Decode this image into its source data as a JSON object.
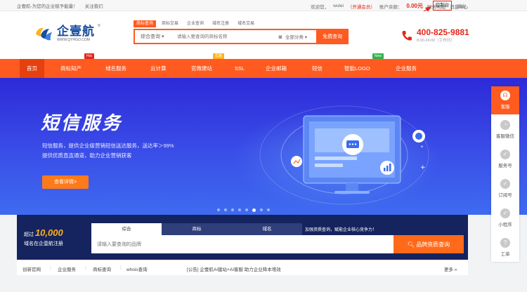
{
  "topbar": {
    "site_slogan": "企壹航-为您的企业赋予能量！",
    "follow": "关注我们",
    "welcome": "欢迎您，",
    "user": "wulei",
    "vip_open": "（开通会员）",
    "balance_label": "账户余额：",
    "balance_value": "0.00元",
    "finance": "财务明细",
    "message_center": "消息中心",
    "console": "控制台",
    "logout": "退出"
  },
  "logo": {
    "cn": "企壹航",
    "en": "WWW.QYHGO.COM",
    "reg": "®"
  },
  "search": {
    "tabs": [
      "商标查询",
      "商标交易",
      "企业查询",
      "域名注册",
      "域名交易"
    ],
    "category": "综合查询 ▾",
    "placeholder": "请输入要查询的商标名称",
    "scope": "全部分类 ▾",
    "button": "免费查询"
  },
  "hotline": {
    "number": "400-825-9881",
    "hours": "8:00-24:00（工作日）"
  },
  "nav": {
    "items": [
      "首页",
      "商标知产",
      "域名服务",
      "云计算",
      "官微建站",
      "SSL",
      "企业邮箱",
      "短信",
      "智能LOGO",
      "企业服务"
    ],
    "badges": {
      "hot": "Hot",
      "discount": "优惠",
      "new": "New"
    }
  },
  "banner": {
    "title": "短信服务",
    "desc1": "短信服务，提供企业级营销短信送达服务，送达率＞99%",
    "desc2": "提供优质直连通道，助力企业营销获客",
    "button": "查看详情>",
    "dots_total": 8,
    "dots_active": 6
  },
  "domain_panel": {
    "promo_prefix": "超过",
    "promo_number": "10,000",
    "promo_line2": "域名在企壹航注册",
    "tabs": [
      "综合",
      "商标",
      "域名"
    ],
    "slogan": "加强资质查询，赋能企业核心竞争力！",
    "placeholder": "请输入要查询的品牌",
    "button": "品牌资质查询"
  },
  "links": {
    "items": [
      "创新官网",
      "企业服务",
      "商标查询",
      "whois查询"
    ],
    "notice": "[公告] 企壹航AI建站+AI客服 助力企业降本增效",
    "more": "更多 »"
  },
  "float_bar": {
    "items": [
      "客服",
      "客服微信",
      "服务号",
      "订阅号",
      "小程序",
      "工单"
    ]
  },
  "colors": {
    "accent": "#ff5a1f",
    "nav_active": "#e5410e",
    "brand_blue": "#1a4fa0",
    "banner_start": "#2d2ad8",
    "banner_end": "#3e6bf0",
    "panel_dark": "#15245e",
    "hot_red": "#e5261a"
  }
}
